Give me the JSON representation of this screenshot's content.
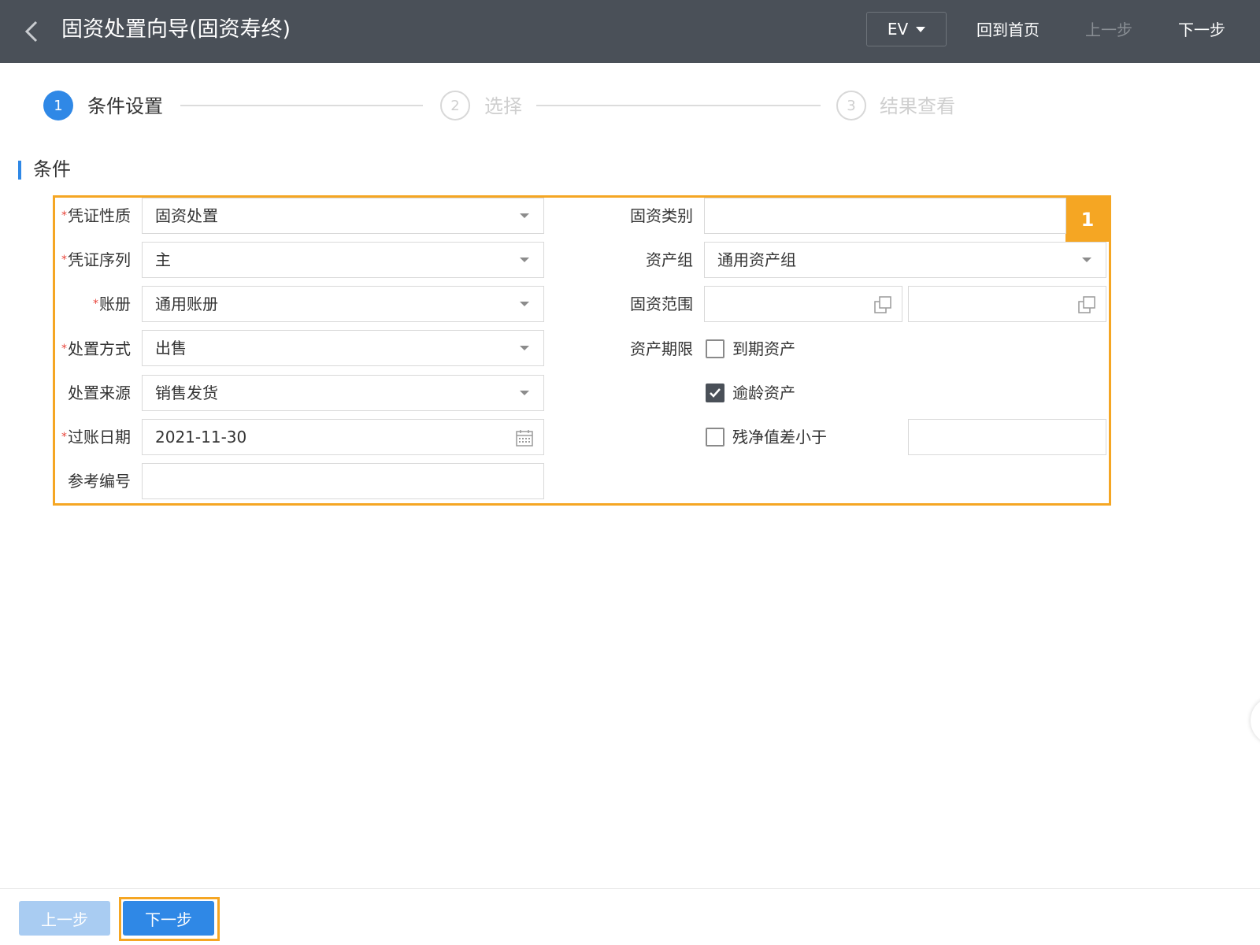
{
  "header": {
    "title": "固资处置向导(固资寿终)",
    "ev_select": "EV",
    "home_link": "回到首页",
    "prev_link": "上一步",
    "next_link": "下一步"
  },
  "steps": [
    {
      "number": "1",
      "label": "条件设置",
      "active": true
    },
    {
      "number": "2",
      "label": "选择",
      "active": false
    },
    {
      "number": "3",
      "label": "结果查看",
      "active": false
    }
  ],
  "section": {
    "title": "条件"
  },
  "annotation_badge": "1",
  "form": {
    "required_mark": "*",
    "voucher_nature": {
      "label": "凭证性质",
      "value": "固资处置"
    },
    "voucher_sequence": {
      "label": "凭证序列",
      "value": "主"
    },
    "ledger": {
      "label": "账册",
      "value": "通用账册"
    },
    "disposal_method": {
      "label": "处置方式",
      "value": "出售"
    },
    "disposal_source": {
      "label": "处置来源",
      "value": "销售发货"
    },
    "posting_date": {
      "label": "过账日期",
      "value": "2021-11-30"
    },
    "reference_no": {
      "label": "参考编号",
      "value": ""
    },
    "asset_category": {
      "label": "固资类别",
      "value": ""
    },
    "asset_group": {
      "label": "资产组",
      "value": "通用资产组"
    },
    "asset_range": {
      "label": "固资范围",
      "from": "",
      "to": ""
    },
    "asset_period": {
      "label": "资产期限",
      "expired": {
        "label": "到期资产",
        "checked": false
      },
      "overage": {
        "label": "逾龄资产",
        "checked": true
      },
      "net_value": {
        "label": "残净值差小于",
        "checked": false,
        "value": ""
      }
    }
  },
  "footer": {
    "prev_button": "上一步",
    "next_button": "下一步"
  },
  "colors": {
    "header_bg": "#4a5058",
    "accent": "#2f88e6",
    "highlight": "#f5a623",
    "required": "#e8443a"
  }
}
